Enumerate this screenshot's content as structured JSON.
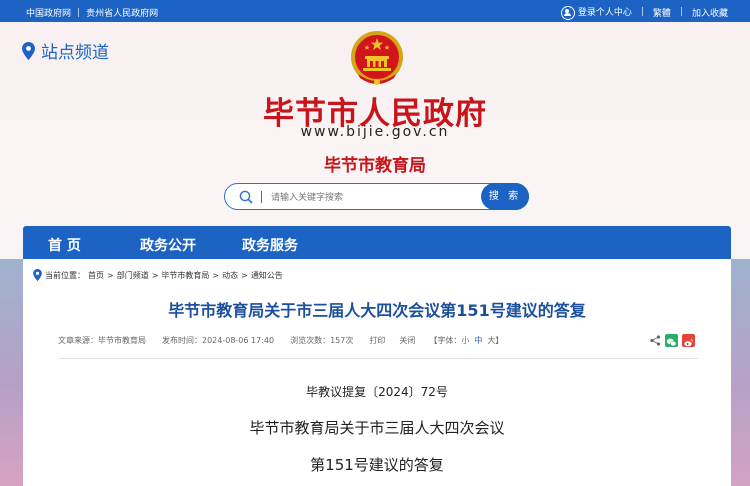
{
  "topbar": {
    "links": [
      "中国政府网",
      "贵州省人民政府网"
    ],
    "login_label": "登录个人中心",
    "traditional_label": "繁體",
    "favorite_label": "加入收藏"
  },
  "header": {
    "site_channel_label": "站点频道",
    "site_title": "毕节市人民政府",
    "site_url": "www.bijie.gov.cn",
    "department": "毕节市教育局"
  },
  "search": {
    "placeholder": "请输入关键字搜索",
    "button_label": "搜 索"
  },
  "nav": {
    "items": [
      "首 页",
      "政务公开",
      "政务服务"
    ]
  },
  "breadcrumb": {
    "prefix": "当前位置：",
    "items": [
      "首页",
      "部门频道",
      "毕节市教育局",
      "动态",
      "通知公告"
    ],
    "separator": ">"
  },
  "article": {
    "title": "毕节市教育局关于市三届人大四次会议第151号建议的答复",
    "meta": {
      "source": "文章来源：毕节市教育局",
      "date": "发布时间：2024-08-06 17:40",
      "views": "浏览次数：157次",
      "print": "打印",
      "close": "关闭",
      "font_prefix": "【字体：",
      "font_small": "小",
      "font_medium": "中",
      "font_large": "大",
      "font_suffix": "】"
    },
    "doc_number": "毕教议提复〔2024〕72号",
    "doc_title_line1": "毕节市教育局关于市三届人大四次会议",
    "doc_title_line2": "第151号建议的答复"
  },
  "colors": {
    "primary_blue": "#1c63c4",
    "title_red": "#c8141b",
    "article_title_blue": "#1c4f9c"
  }
}
